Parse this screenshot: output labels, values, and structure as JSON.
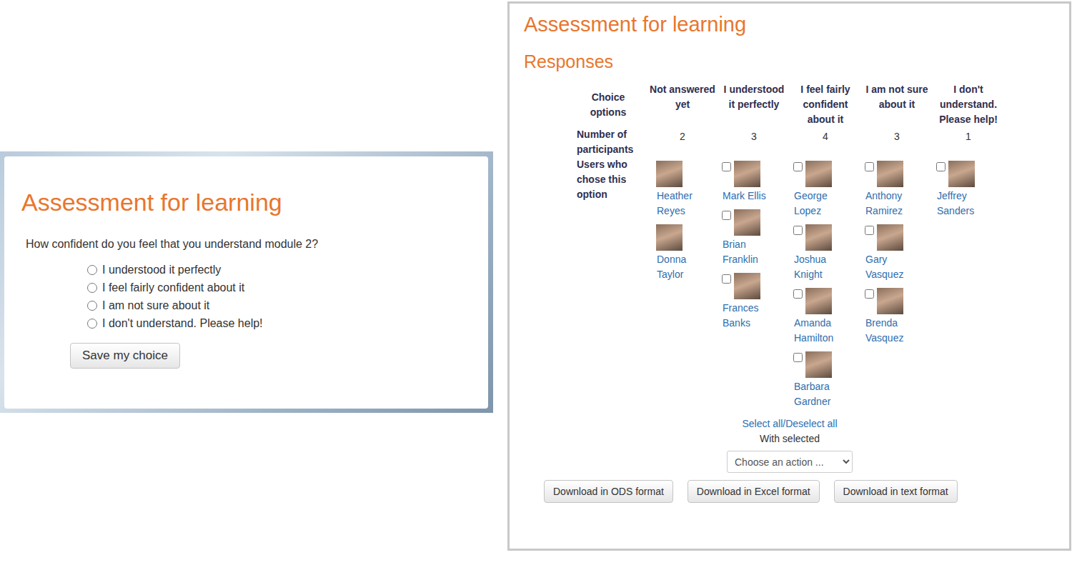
{
  "form_panel": {
    "title": "Assessment for learning",
    "question": "How confident do you feel that you understand module 2?",
    "options": [
      {
        "label": "I understood it perfectly",
        "selected": false
      },
      {
        "label": "I feel fairly confident about it",
        "selected": false
      },
      {
        "label": "I am not sure about it",
        "selected": false
      },
      {
        "label": "I don't understand. Please help!",
        "selected": false
      }
    ],
    "button": "Save my choice"
  },
  "responses_panel": {
    "title": "Assessment for learning",
    "subtitle": "Responses",
    "table": {
      "row_labels": {
        "options": "Choice options",
        "count": "Number of participants",
        "users": "Users who chose this option"
      },
      "columns": [
        {
          "header": "Not answered yet",
          "count": "2",
          "checkbox": false,
          "users": [
            {
              "name": "Heather Reyes",
              "checked": false
            },
            {
              "name": "Donna Taylor",
              "checked": false
            }
          ]
        },
        {
          "header": "I understood it perfectly",
          "count": "3",
          "checkbox": true,
          "users": [
            {
              "name": "Mark Ellis",
              "checked": false
            },
            {
              "name": "Brian Franklin",
              "checked": false
            },
            {
              "name": "Frances Banks",
              "checked": false
            }
          ]
        },
        {
          "header": "I feel fairly confident about it",
          "count": "4",
          "checkbox": true,
          "users": [
            {
              "name": "George Lopez",
              "checked": false
            },
            {
              "name": "Joshua Knight",
              "checked": false
            },
            {
              "name": "Amanda Hamilton",
              "checked": false
            },
            {
              "name": "Barbara Gardner",
              "checked": false
            }
          ]
        },
        {
          "header": "I am not sure about it",
          "count": "3",
          "checkbox": true,
          "users": [
            {
              "name": "Anthony Ramirez",
              "checked": false
            },
            {
              "name": "Gary Vasquez",
              "checked": false
            },
            {
              "name": "Brenda Vasquez",
              "checked": false
            }
          ]
        },
        {
          "header": "I don't understand. Please help!",
          "count": "1",
          "checkbox": true,
          "users": [
            {
              "name": "Jeffrey Sanders",
              "checked": false
            }
          ]
        }
      ]
    },
    "select_all": "Select all",
    "separator": "/",
    "deselect_all": "Deselect all",
    "with_selected": "With selected",
    "action_select": {
      "placeholder": "Choose an action ..."
    },
    "downloads": [
      "Download in ODS format",
      "Download in Excel format",
      "Download in text format"
    ]
  }
}
